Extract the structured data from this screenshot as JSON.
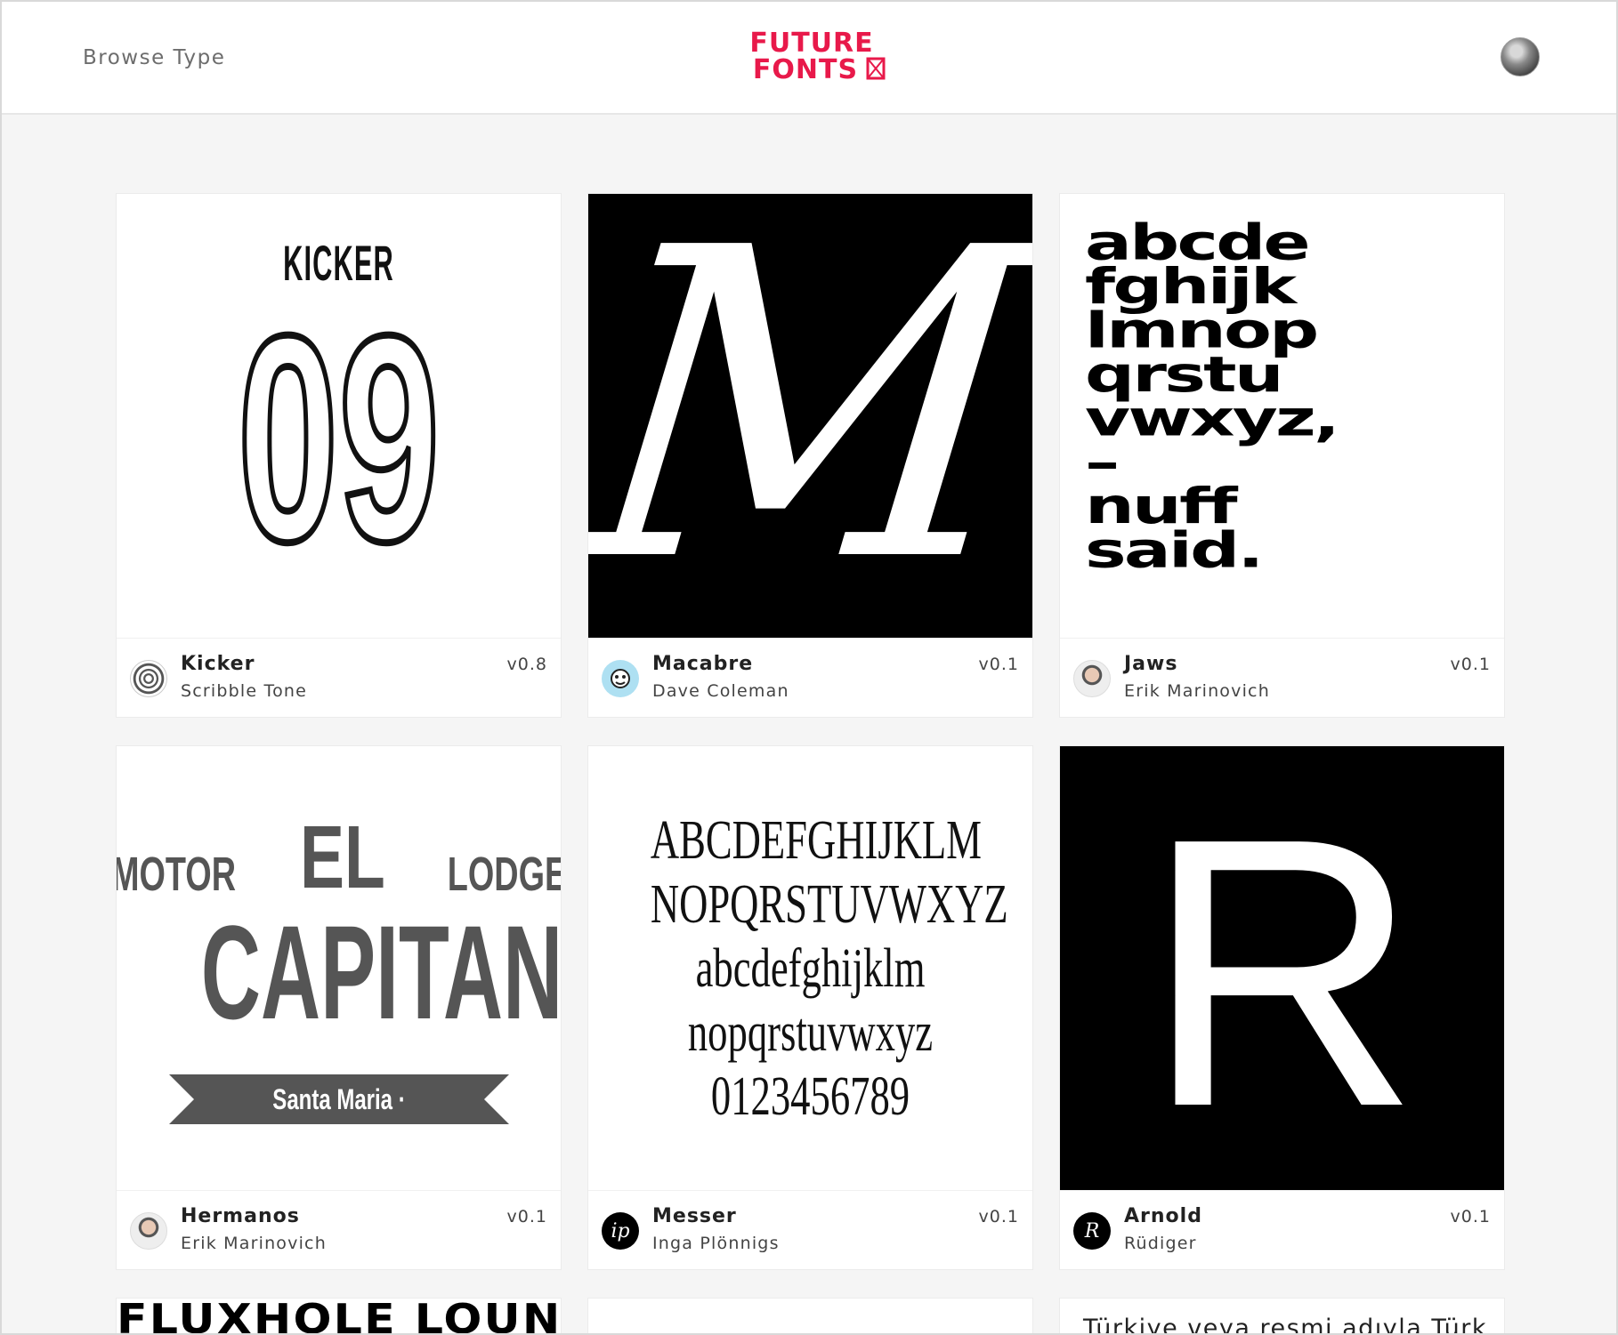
{
  "header": {
    "browse_label": "Browse Type",
    "logo_line1": "FUTURE",
    "logo_line2": "FONTS",
    "logo_color": "#e8194a"
  },
  "cards": [
    {
      "name": "Kicker",
      "author": "Scribble Tone",
      "version": "v0.8",
      "preview_title": "KICKER",
      "preview_text": "09"
    },
    {
      "name": "Macabre",
      "author": "Dave Coleman",
      "version": "v0.1",
      "preview_text": "M"
    },
    {
      "name": "Jaws",
      "author": "Erik Marinovich",
      "version": "v0.1",
      "preview_text": "abcde\nfghijk\nlmnop\nqrstu\nvwxyz,\n–\nnuff\nsaid."
    },
    {
      "name": "Hermanos",
      "author": "Erik Marinovich",
      "version": "v0.1",
      "preview_motor": "MOTOR",
      "preview_el": "EL",
      "preview_lodge": "LODGE",
      "preview_capitan": "CAPITAN",
      "preview_ribbon": "Santa Maria · California"
    },
    {
      "name": "Messer",
      "author": "Inga Plönnigs",
      "version": "v0.1",
      "preview_lines": [
        "ABCDEFGHIJKLM",
        "NOPQRSTUVWXYZ",
        "abcdefghijklm",
        "nopqrstuvwxyz",
        "0123456789"
      ]
    },
    {
      "name": "Arnold",
      "author": "Rüdiger",
      "version": "v0.1",
      "preview_text": "R"
    }
  ],
  "partial_cards": [
    {
      "preview_text": "FLUXHOLE LOUNGE"
    },
    {
      "preview_text": ""
    },
    {
      "preview_text": "Türkiye veya resmi adıyla Türk"
    }
  ]
}
